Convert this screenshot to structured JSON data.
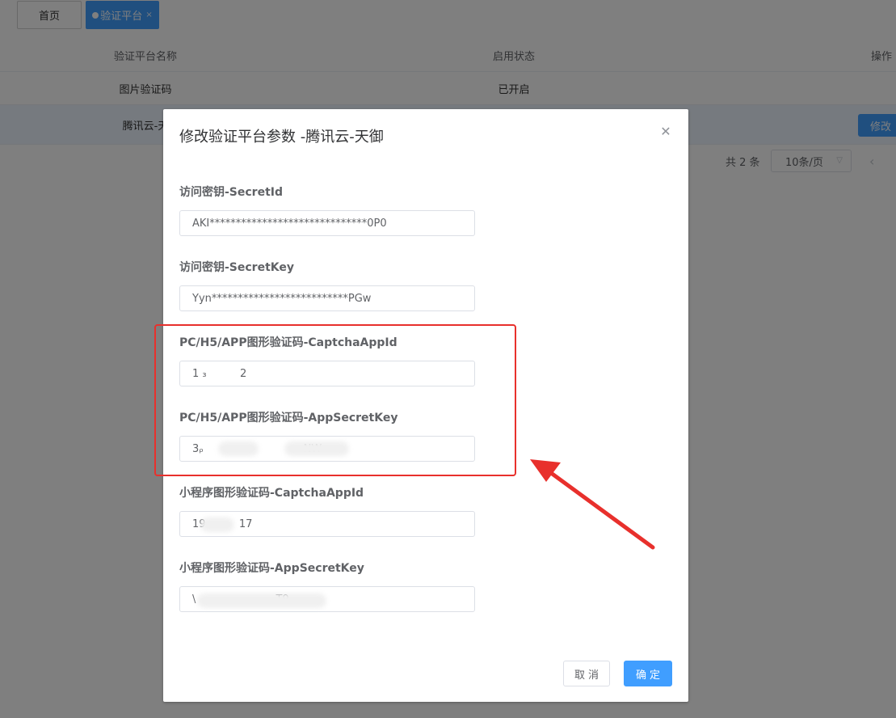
{
  "tabs": {
    "home": "首页",
    "active": "验证平台",
    "close": "×"
  },
  "table": {
    "headers": [
      "验证平台名称",
      "启用状态",
      "操作"
    ],
    "rows": [
      {
        "name": "图片验证码",
        "status": "已开启",
        "action": ""
      },
      {
        "name": "腾讯云-天",
        "status": "",
        "action": "修改"
      }
    ]
  },
  "pagination": {
    "total": "共 2 条",
    "page_size": "10条/页"
  },
  "dialog": {
    "title": "修改验证平台参数 -腾讯云-天御",
    "fields": [
      {
        "label": "访问密钥-SecretId",
        "value": "AKI******************************0P0"
      },
      {
        "label": "访问密钥-SecretKey",
        "value": "Yyn**************************PGw"
      },
      {
        "label": "PC/H5/APP图形验证码-CaptchaAppId",
        "value": "1 ₃          2"
      },
      {
        "label": "PC/H5/APP图形验证码-AppSecretKey",
        "value": "3ᵨ                              NW"
      },
      {
        "label": "小程序图形验证码-CaptchaAppId",
        "value": "19          17"
      },
      {
        "label": "小程序图形验证码-AppSecretKey",
        "value": "\\                        T9"
      }
    ],
    "cancel": "取消",
    "confirm": "确定"
  },
  "colors": {
    "primary": "#409eff",
    "annotation": "#e8302c"
  }
}
